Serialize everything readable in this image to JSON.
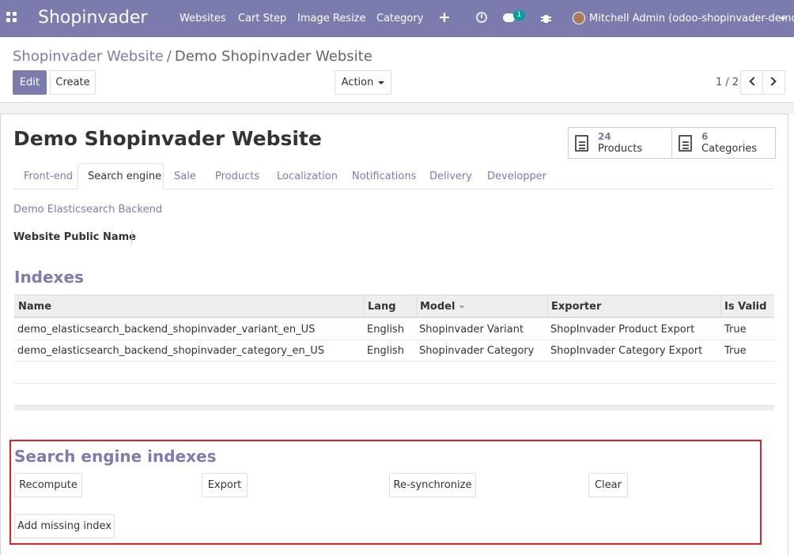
{
  "navbar": {
    "brand": "Shopinvader",
    "menu": [
      "Websites",
      "Cart Step",
      "Image Resize",
      "Category"
    ],
    "chat_count": "1",
    "user": "Mitchell Admin (odoo-shopinvader-demo)",
    "icons": [
      "apps-grid-icon",
      "plus-icon",
      "clock-icon",
      "chat-icon",
      "bug-icon",
      "avatar",
      "caret-down-icon"
    ]
  },
  "breadcrumb": {
    "parent": "Shopinvader Website",
    "separator": "/",
    "current": "Demo Shopinvader Website"
  },
  "buttons": {
    "edit": "Edit",
    "create": "Create",
    "action": "Action"
  },
  "pager": {
    "value": "1 / 2"
  },
  "record": {
    "title": "Demo Shopinvader Website"
  },
  "stats": [
    {
      "count": "24",
      "label": "Products"
    },
    {
      "count": "6",
      "label": "Categories"
    }
  ],
  "tabs": [
    "Front-end",
    "Search engine",
    "Sale",
    "Products",
    "Localization",
    "Notifications",
    "Delivery",
    "Developper"
  ],
  "active_tab": "Search engine",
  "search_engine": {
    "backend_link": "Demo Elasticsearch Backend",
    "public_name_label": "Website Public Name",
    "indexes_title": "Indexes",
    "columns": [
      "Name",
      "Lang",
      "Model",
      "Exporter",
      "Is Valid"
    ],
    "rows": [
      {
        "name": "demo_elasticsearch_backend_shopinvader_variant_en_US",
        "lang": "English",
        "model": "Shopinvader Variant",
        "exporter": "ShopInvader Product Export",
        "valid": "True"
      },
      {
        "name": "demo_elasticsearch_backend_shopinvader_category_en_US",
        "lang": "English",
        "model": "Shopinvader Category",
        "exporter": "ShopInvader Category Export",
        "valid": "True"
      }
    ],
    "actions_title": "Search engine indexes",
    "actions": {
      "recompute": "Recompute",
      "export": "Export",
      "resync": "Re-synchronize",
      "clear": "Clear",
      "add_missing": "Add missing index"
    }
  },
  "colors": {
    "brand": "#7c7bad",
    "highlight": "#e0202a",
    "badge": "#00a09d"
  }
}
